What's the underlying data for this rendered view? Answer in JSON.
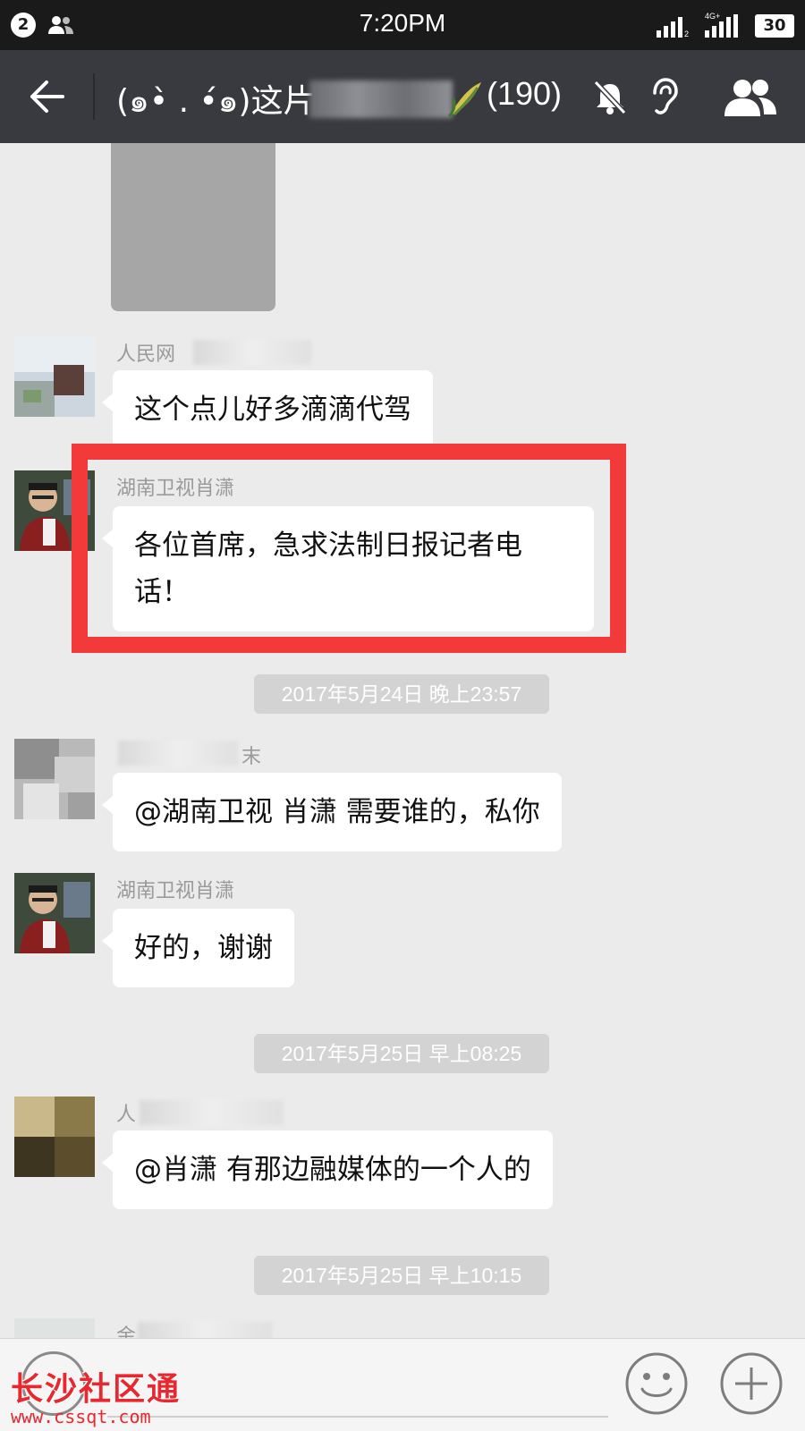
{
  "status_bar": {
    "notification_count": "2",
    "time": "7:20PM",
    "network_label": "4G+",
    "battery": "30"
  },
  "header": {
    "title_prefix": "(๑•̀ . •́๑)这片",
    "member_count": "(190)"
  },
  "messages": [
    {
      "sender": "人民网",
      "text": "这个点儿好多滴滴代驾"
    },
    {
      "sender": "湖南卫视肖潇",
      "text": "各位首席，急求法制日报记者电话！"
    },
    {
      "sender": "末",
      "text": "@湖南卫视 肖潇  需要谁的，私你"
    },
    {
      "sender": "湖南卫视肖潇",
      "text": "好的，谢谢"
    },
    {
      "sender": "人",
      "text": "@肖潇 有那边融媒体的一个人的"
    },
    {
      "sender": "金"
    }
  ],
  "timestamps": [
    "2017年5月24日 晚上23:57",
    "2017年5月25日 早上08:25",
    "2017年5月25日 早上10:15"
  ],
  "watermark": {
    "name": "长沙社区通",
    "url": "www.cssqt.com"
  },
  "colors": {
    "highlight": "#f23a3a",
    "title_bar": "#393a3f",
    "background": "#ebebeb"
  },
  "icons": [
    "people-icon",
    "signal-icon",
    "battery-icon",
    "back-arrow-icon",
    "leaf-icon",
    "mute-bell-icon",
    "ear-icon",
    "group-members-icon",
    "voice-icon",
    "emoji-icon",
    "plus-icon"
  ]
}
